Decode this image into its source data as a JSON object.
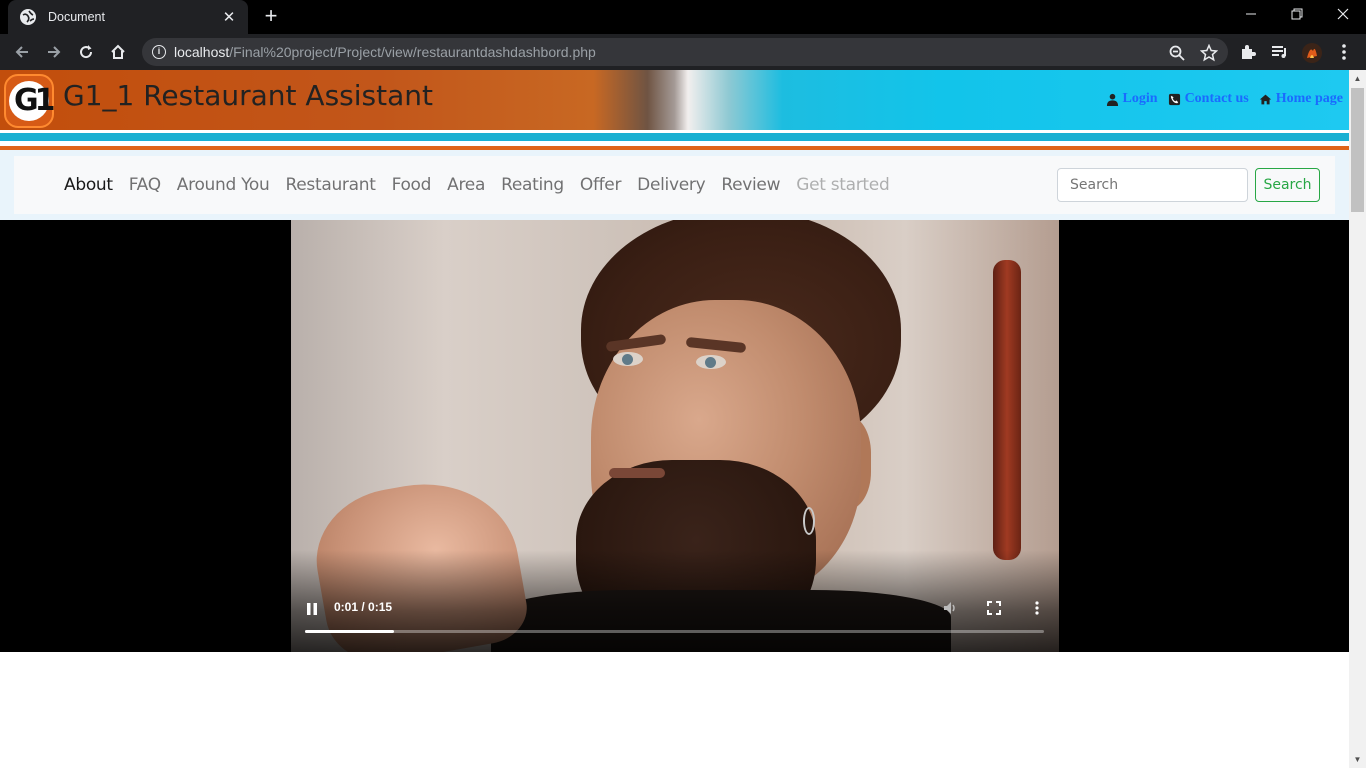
{
  "browser": {
    "tab_title": "Document",
    "tab_close": "✕",
    "new_tab": "+",
    "url_host": "localhost",
    "url_path": "/Final%20project/Project/view/restaurantdashdashbord.php"
  },
  "site": {
    "logo_text": "G1",
    "title": "G1_1 Restaurant Assistant",
    "top_links": {
      "login": "Login",
      "contact": "Contact us",
      "home": "Home page"
    }
  },
  "nav": {
    "items": [
      "About",
      "FAQ",
      "Around You",
      "Restaurant",
      "Food",
      "Area",
      "Reating",
      "Offer",
      "Delivery",
      "Review",
      "Get started"
    ],
    "search_placeholder": "Search",
    "search_button": "Search"
  },
  "video": {
    "time": "0:01 / 0:15",
    "progress": 0.12
  },
  "colors": {
    "link": "#1a6aff",
    "search_button": "#28a745",
    "banner_orange": "#c24e0c",
    "banner_cyan": "#12c4ea"
  }
}
